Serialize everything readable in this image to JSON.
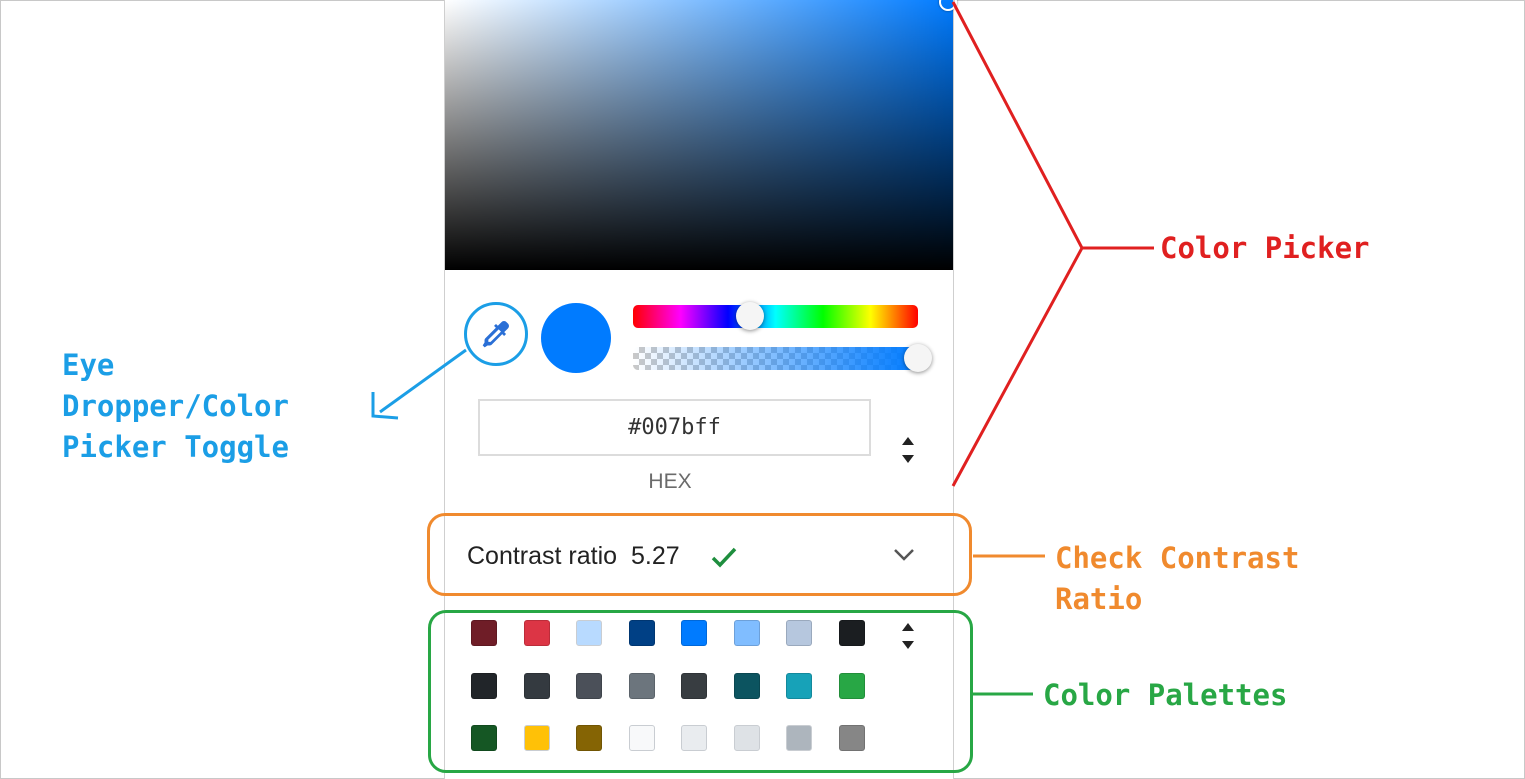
{
  "color_picker": {
    "selected_hex": "#007bff",
    "hex_value": "#007bff",
    "format_label": "HEX",
    "hue_fraction": 0.41,
    "alpha_fraction": 1.0
  },
  "contrast": {
    "label": "Contrast ratio",
    "value": "5.27"
  },
  "palette_colors": [
    "#6f1d27",
    "#dc3545",
    "#b8daff",
    "#004085",
    "#007bff",
    "#80bdff",
    "#b6c7de",
    "#1b1e21",
    "#212529",
    "#343a40",
    "#4b5059",
    "#6c757d",
    "#383d41",
    "#0c5460",
    "#17a2b8",
    "#28a745",
    "#155724",
    "#ffc107",
    "#856404",
    "#f8f9fa",
    "#e9ecef",
    "#dee2e6",
    "#adb5bd",
    "#868686"
  ],
  "annotations": {
    "color_picker": "Color Picker",
    "eye_dropper": "Eye\nDropper/Color\nPicker Toggle",
    "check_contrast": "Check Contrast\nRatio",
    "color_palettes": "Color Palettes"
  },
  "annotation_colors": {
    "red": "#e02020",
    "blue": "#1b9ee6",
    "orange": "#f08a2e",
    "green": "#28a745"
  },
  "icons": [
    "eyedropper-icon",
    "up-down-stepper-icon",
    "checkmark-icon",
    "chevron-down-icon"
  ]
}
